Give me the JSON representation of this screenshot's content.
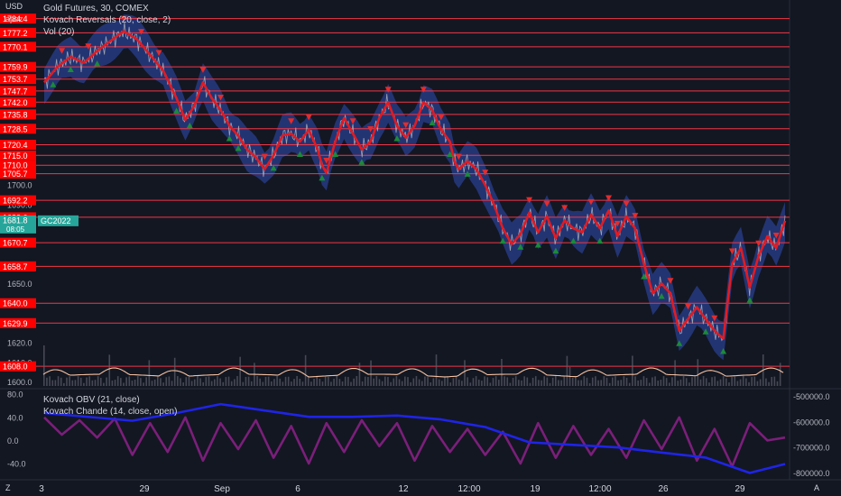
{
  "header": {
    "currency": "USD",
    "user": "apoz",
    "zoom_label": "Z",
    "auto_label": "A"
  },
  "legend": {
    "main_title": "Gold Futures, 30, COMEX",
    "indicator_1": "Kovach Reversals (20, close, 2)",
    "indicator_2": "Vol (20)",
    "lower_1": "Kovach OBV (21, close)",
    "lower_2": "Kovach Chande (14, close, open)"
  },
  "colors": {
    "background": "#131722",
    "level_line": "#f23645",
    "label_bg": "#ff0000",
    "price_tag_bg": "#26a69a",
    "band": "#2a3f8f",
    "main_line": "#e01b24",
    "up_marker": "#1b8a3a",
    "down_marker": "#e52b2b",
    "obv_line": "#1f24e6",
    "chande_line": "#7b1f7a",
    "grid": "#1e222d",
    "text": "#d1d4dc"
  },
  "chart_data": {
    "type": "line",
    "symbol": "GC2022",
    "price_tag": {
      "value": "1681.8",
      "countdown": "08:05"
    },
    "x_ticks": [
      "3",
      "29",
      "Sep",
      "6",
      "12",
      "12:00",
      "19",
      "12:00",
      "26",
      "29"
    ],
    "y_ticks": [
      "1700.0",
      "1690.0",
      "1680.0",
      "1650.0",
      "1620.0",
      "1610.0",
      "1600.0"
    ],
    "levels": [
      "1784.4",
      "1777.2",
      "1770.1",
      "1759.9",
      "1753.7",
      "1747.7",
      "1742.0",
      "1735.8",
      "1728.5",
      "1720.4",
      "1715.0",
      "1710.0",
      "1705.7",
      "1692.2",
      "1683.6",
      "1670.7",
      "1658.7",
      "1640.0",
      "1629.9",
      "1608.0"
    ],
    "ylim": [
      1598,
      1792
    ],
    "price_series": [
      {
        "t": 0,
        "v": 1752
      },
      {
        "t": 3,
        "v": 1760
      },
      {
        "t": 6,
        "v": 1765
      },
      {
        "t": 9,
        "v": 1762
      },
      {
        "t": 12,
        "v": 1768
      },
      {
        "t": 15,
        "v": 1773
      },
      {
        "t": 18,
        "v": 1778
      },
      {
        "t": 21,
        "v": 1774
      },
      {
        "t": 24,
        "v": 1766
      },
      {
        "t": 27,
        "v": 1758
      },
      {
        "t": 30,
        "v": 1744
      },
      {
        "t": 32,
        "v": 1733
      },
      {
        "t": 34,
        "v": 1740
      },
      {
        "t": 36,
        "v": 1752
      },
      {
        "t": 38,
        "v": 1744
      },
      {
        "t": 40,
        "v": 1738
      },
      {
        "t": 42,
        "v": 1730
      },
      {
        "t": 44,
        "v": 1725
      },
      {
        "t": 46,
        "v": 1718
      },
      {
        "t": 48,
        "v": 1714
      },
      {
        "t": 50,
        "v": 1708
      },
      {
        "t": 52,
        "v": 1715
      },
      {
        "t": 54,
        "v": 1725
      },
      {
        "t": 56,
        "v": 1726
      },
      {
        "t": 58,
        "v": 1722
      },
      {
        "t": 60,
        "v": 1728
      },
      {
        "t": 62,
        "v": 1718
      },
      {
        "t": 63,
        "v": 1710
      },
      {
        "t": 64,
        "v": 1706
      },
      {
        "t": 66,
        "v": 1722
      },
      {
        "t": 68,
        "v": 1734
      },
      {
        "t": 70,
        "v": 1726
      },
      {
        "t": 72,
        "v": 1718
      },
      {
        "t": 74,
        "v": 1722
      },
      {
        "t": 76,
        "v": 1734
      },
      {
        "t": 78,
        "v": 1742
      },
      {
        "t": 80,
        "v": 1730
      },
      {
        "t": 82,
        "v": 1724
      },
      {
        "t": 84,
        "v": 1730
      },
      {
        "t": 86,
        "v": 1742
      },
      {
        "t": 88,
        "v": 1738
      },
      {
        "t": 90,
        "v": 1728
      },
      {
        "t": 92,
        "v": 1722
      },
      {
        "t": 93,
        "v": 1712
      },
      {
        "t": 94,
        "v": 1708
      },
      {
        "t": 96,
        "v": 1712
      },
      {
        "t": 98,
        "v": 1708
      },
      {
        "t": 100,
        "v": 1700
      },
      {
        "t": 102,
        "v": 1690
      },
      {
        "t": 104,
        "v": 1678
      },
      {
        "t": 106,
        "v": 1670
      },
      {
        "t": 108,
        "v": 1675
      },
      {
        "t": 110,
        "v": 1686
      },
      {
        "t": 112,
        "v": 1676
      },
      {
        "t": 114,
        "v": 1684
      },
      {
        "t": 116,
        "v": 1673
      },
      {
        "t": 118,
        "v": 1682
      },
      {
        "t": 120,
        "v": 1678
      },
      {
        "t": 122,
        "v": 1676
      },
      {
        "t": 124,
        "v": 1685
      },
      {
        "t": 126,
        "v": 1678
      },
      {
        "t": 128,
        "v": 1687
      },
      {
        "t": 130,
        "v": 1674
      },
      {
        "t": 132,
        "v": 1684
      },
      {
        "t": 134,
        "v": 1678
      },
      {
        "t": 136,
        "v": 1660
      },
      {
        "t": 138,
        "v": 1645
      },
      {
        "t": 140,
        "v": 1650
      },
      {
        "t": 142,
        "v": 1645
      },
      {
        "t": 144,
        "v": 1626
      },
      {
        "t": 146,
        "v": 1632
      },
      {
        "t": 148,
        "v": 1638
      },
      {
        "t": 150,
        "v": 1632
      },
      {
        "t": 152,
        "v": 1626
      },
      {
        "t": 154,
        "v": 1622
      },
      {
        "t": 156,
        "v": 1660
      },
      {
        "t": 158,
        "v": 1668
      },
      {
        "t": 160,
        "v": 1648
      },
      {
        "t": 162,
        "v": 1664
      },
      {
        "t": 164,
        "v": 1674
      },
      {
        "t": 166,
        "v": 1668
      },
      {
        "t": 168,
        "v": 1681.8
      }
    ],
    "obv_ylim": [
      -820000,
      -480000
    ],
    "obv_ticks": [
      "-500000.0",
      "-600000.0",
      "-700000.0",
      "-800000.0"
    ],
    "obv_series": [
      {
        "t": 0,
        "v": -565000
      },
      {
        "t": 20,
        "v": -595000
      },
      {
        "t": 30,
        "v": -565000
      },
      {
        "t": 40,
        "v": -530000
      },
      {
        "t": 50,
        "v": -555000
      },
      {
        "t": 60,
        "v": -580000
      },
      {
        "t": 70,
        "v": -580000
      },
      {
        "t": 80,
        "v": -575000
      },
      {
        "t": 90,
        "v": -590000
      },
      {
        "t": 100,
        "v": -620000
      },
      {
        "t": 110,
        "v": -680000
      },
      {
        "t": 120,
        "v": -690000
      },
      {
        "t": 130,
        "v": -700000
      },
      {
        "t": 140,
        "v": -720000
      },
      {
        "t": 150,
        "v": -740000
      },
      {
        "t": 160,
        "v": -800000
      },
      {
        "t": 168,
        "v": -765000
      }
    ],
    "chande_ylim": [
      -65,
      85
    ],
    "chande_ticks": [
      "80.0",
      "40.0",
      "0.0",
      "-40.0"
    ],
    "chande_series": [
      {
        "t": 0,
        "v": 40
      },
      {
        "t": 4,
        "v": 10
      },
      {
        "t": 8,
        "v": 35
      },
      {
        "t": 12,
        "v": 5
      },
      {
        "t": 16,
        "v": 38
      },
      {
        "t": 20,
        "v": -25
      },
      {
        "t": 24,
        "v": 30
      },
      {
        "t": 28,
        "v": -20
      },
      {
        "t": 32,
        "v": 40
      },
      {
        "t": 36,
        "v": -35
      },
      {
        "t": 40,
        "v": 30
      },
      {
        "t": 44,
        "v": -15
      },
      {
        "t": 48,
        "v": 35
      },
      {
        "t": 52,
        "v": -30
      },
      {
        "t": 56,
        "v": 25
      },
      {
        "t": 60,
        "v": -40
      },
      {
        "t": 64,
        "v": 30
      },
      {
        "t": 68,
        "v": -20
      },
      {
        "t": 72,
        "v": 35
      },
      {
        "t": 76,
        "v": -10
      },
      {
        "t": 80,
        "v": 30
      },
      {
        "t": 84,
        "v": -35
      },
      {
        "t": 88,
        "v": 25
      },
      {
        "t": 92,
        "v": -20
      },
      {
        "t": 96,
        "v": 20
      },
      {
        "t": 100,
        "v": -25
      },
      {
        "t": 104,
        "v": 15
      },
      {
        "t": 108,
        "v": -40
      },
      {
        "t": 112,
        "v": 30
      },
      {
        "t": 116,
        "v": -30
      },
      {
        "t": 120,
        "v": 25
      },
      {
        "t": 124,
        "v": -25
      },
      {
        "t": 128,
        "v": 20
      },
      {
        "t": 132,
        "v": -30
      },
      {
        "t": 136,
        "v": 35
      },
      {
        "t": 140,
        "v": -15
      },
      {
        "t": 144,
        "v": 40
      },
      {
        "t": 148,
        "v": -35
      },
      {
        "t": 152,
        "v": 20
      },
      {
        "t": 156,
        "v": -45
      },
      {
        "t": 160,
        "v": 30
      },
      {
        "t": 164,
        "v": 0
      },
      {
        "t": 168,
        "v": 5
      }
    ],
    "up_markers_at": [
      2,
      6,
      12,
      30,
      33,
      42,
      44,
      52,
      58,
      63,
      66,
      72,
      80,
      88,
      92,
      96,
      104,
      108,
      112,
      116,
      120,
      126,
      136,
      140,
      144,
      150,
      154,
      160
    ],
    "down_markers_at": [
      4,
      10,
      18,
      22,
      26,
      36,
      40,
      50,
      56,
      60,
      64,
      70,
      74,
      78,
      82,
      86,
      90,
      94,
      100,
      110,
      114,
      118,
      124,
      128,
      130,
      132,
      134,
      142,
      146,
      152,
      156,
      162,
      166
    ]
  }
}
